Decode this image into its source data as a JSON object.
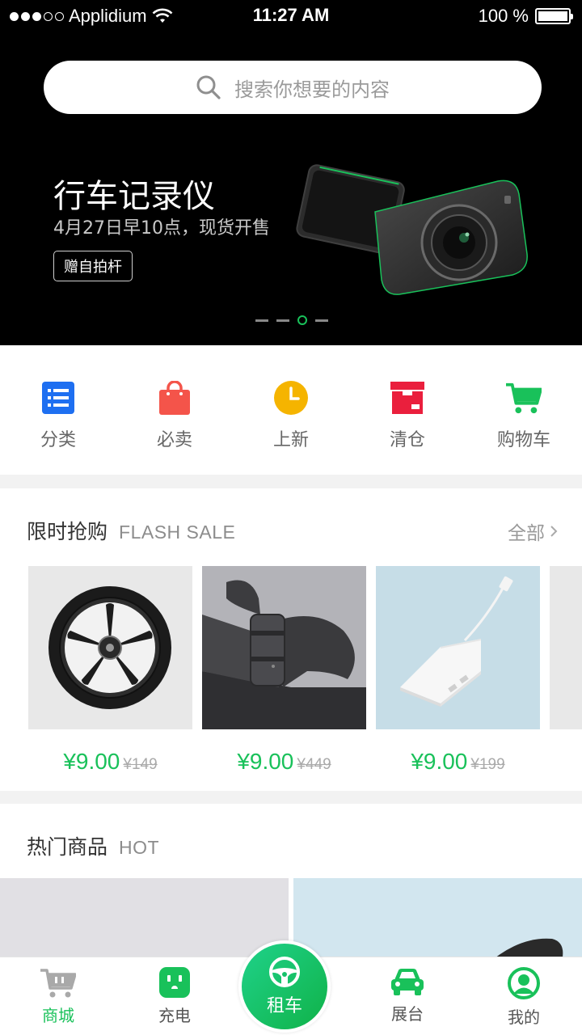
{
  "status_bar": {
    "carrier": "Applidium",
    "time": "11:27 AM",
    "battery": "100 %"
  },
  "search": {
    "placeholder": "搜索你想要的内容"
  },
  "banner": {
    "title": "行车记录仪",
    "subtitle": "4月27日早10点，现货开售",
    "tag": "赠自拍杆",
    "active_indicator": 2,
    "indicator_count": 4
  },
  "categories": [
    {
      "label": "分类",
      "icon": "list-icon",
      "color": "#1e6ff1"
    },
    {
      "label": "必卖",
      "icon": "shopping-bag-icon",
      "color": "#f4544a"
    },
    {
      "label": "上新",
      "icon": "clock-icon",
      "color": "#f5b400"
    },
    {
      "label": "清仓",
      "icon": "box-icon",
      "color": "#ea1f3d"
    },
    {
      "label": "购物车",
      "icon": "cart-icon",
      "color": "#19c15a"
    }
  ],
  "flash_sale": {
    "title": "限时抢购",
    "subtitle": "FLASH SALE",
    "all_label": "全部",
    "products": [
      {
        "price": "¥9.00",
        "old_price": "¥149",
        "image": "wheel-image"
      },
      {
        "price": "¥9.00",
        "old_price": "¥449",
        "image": "car-seat-image"
      },
      {
        "price": "¥9.00",
        "old_price": "¥199",
        "image": "adapter-image"
      }
    ]
  },
  "hot": {
    "title": "热门商品",
    "subtitle": "HOT"
  },
  "tabbar": {
    "items": [
      {
        "label": "商城",
        "icon": "cart-icon",
        "active": true
      },
      {
        "label": "充电",
        "icon": "socket-icon",
        "active": false
      },
      {
        "label": "租车",
        "icon": "steering-wheel-icon",
        "active": false
      },
      {
        "label": "展台",
        "icon": "car-icon",
        "active": false
      },
      {
        "label": "我的",
        "icon": "user-icon",
        "active": false
      }
    ]
  },
  "colors": {
    "accent": "#19c15a",
    "banner_bg": "#000000"
  }
}
